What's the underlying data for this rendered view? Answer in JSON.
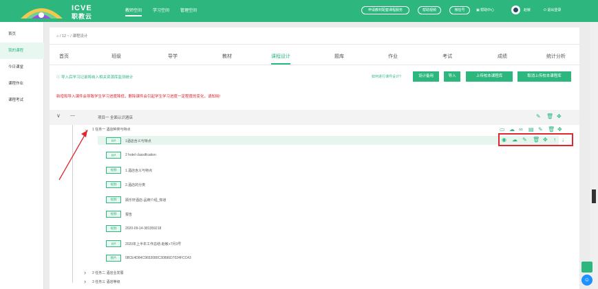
{
  "header": {
    "brand": {
      "line1": "ICVE",
      "line2": "职教云"
    },
    "nav": [
      {
        "label": "教师空间"
      },
      {
        "label": "学习空间"
      },
      {
        "label": "管理空间"
      }
    ],
    "pills": [
      {
        "label": "申请教材配套课程服务"
      },
      {
        "label": "帮助视频"
      },
      {
        "label": "微信号"
      }
    ],
    "help_label": "帮助中心",
    "user_name": "赵敏",
    "logout_label": "退出登录"
  },
  "sidebar": {
    "items": [
      {
        "label": "首页"
      },
      {
        "label": "我的课程"
      },
      {
        "label": "今日课堂"
      },
      {
        "label": "课程作业"
      },
      {
        "label": "课程考试"
      }
    ]
  },
  "breadcrumb": "⌂ / 12 ~ / 课程设计",
  "tabs": [
    {
      "label": "首页"
    },
    {
      "label": "班级"
    },
    {
      "label": "导学"
    },
    {
      "label": "教材"
    },
    {
      "label": "课程设计"
    },
    {
      "label": "题库"
    },
    {
      "label": "作业"
    },
    {
      "label": "考试"
    },
    {
      "label": "成绩"
    },
    {
      "label": "统计分析"
    }
  ],
  "info_text": "ⓘ 导入后学习记录将纳入相关资源库监测统计",
  "help_link": "如何进行课件设计?",
  "buttons": [
    {
      "label": "设计备用"
    },
    {
      "label": "导入"
    },
    {
      "label": "上传校本课程库"
    },
    {
      "label": "取消上传校本课程库"
    }
  ],
  "warning": "新增和导入课件会导致学生学习进度降低，删除课件会引起学生学习进度一定程度的变化，请知晓!",
  "project": {
    "label": "项目一 全面认识酒店"
  },
  "tasks": [
    {
      "label": "1 任务一 酒店种类与特点"
    },
    {
      "label": "2 任务二 酒店业发展"
    },
    {
      "label": "3 任务三 酒店等级"
    }
  ],
  "resources": [
    {
      "type": "ppt",
      "name": "1酒店含义与特点"
    },
    {
      "type": "ppt",
      "name": "2 hotel classification"
    },
    {
      "type": "视频",
      "name": "1.酒店含义与特点"
    },
    {
      "type": "视频",
      "name": "2.酒店的分类"
    },
    {
      "type": "视频",
      "name": "顾乐轩酒店-品牌介绍_知道"
    },
    {
      "type": "视频",
      "name": "报告"
    },
    {
      "type": "视频",
      "name": "2020-09-14-381359218"
    },
    {
      "type": "ppt",
      "name": "2020年上半年工作总结-赵敏+7月3号"
    },
    {
      "type": "图片",
      "name": "08CE4D84C9653080C30896D7024FCC43"
    }
  ],
  "icons": {
    "project_actions": [
      "edit-icon",
      "trash-icon",
      "move-icon"
    ],
    "task_actions": [
      "folder-icon",
      "upload-icon",
      "link-icon",
      "doc-icon",
      "edit-icon",
      "trash-icon",
      "move-icon"
    ],
    "row_actions": [
      "eye-icon",
      "upload-icon",
      "edit-icon",
      "trash-icon",
      "move-icon",
      "up-icon",
      "down-icon"
    ]
  },
  "colors": {
    "primary": "#2db77f",
    "danger": "#e0262f"
  }
}
